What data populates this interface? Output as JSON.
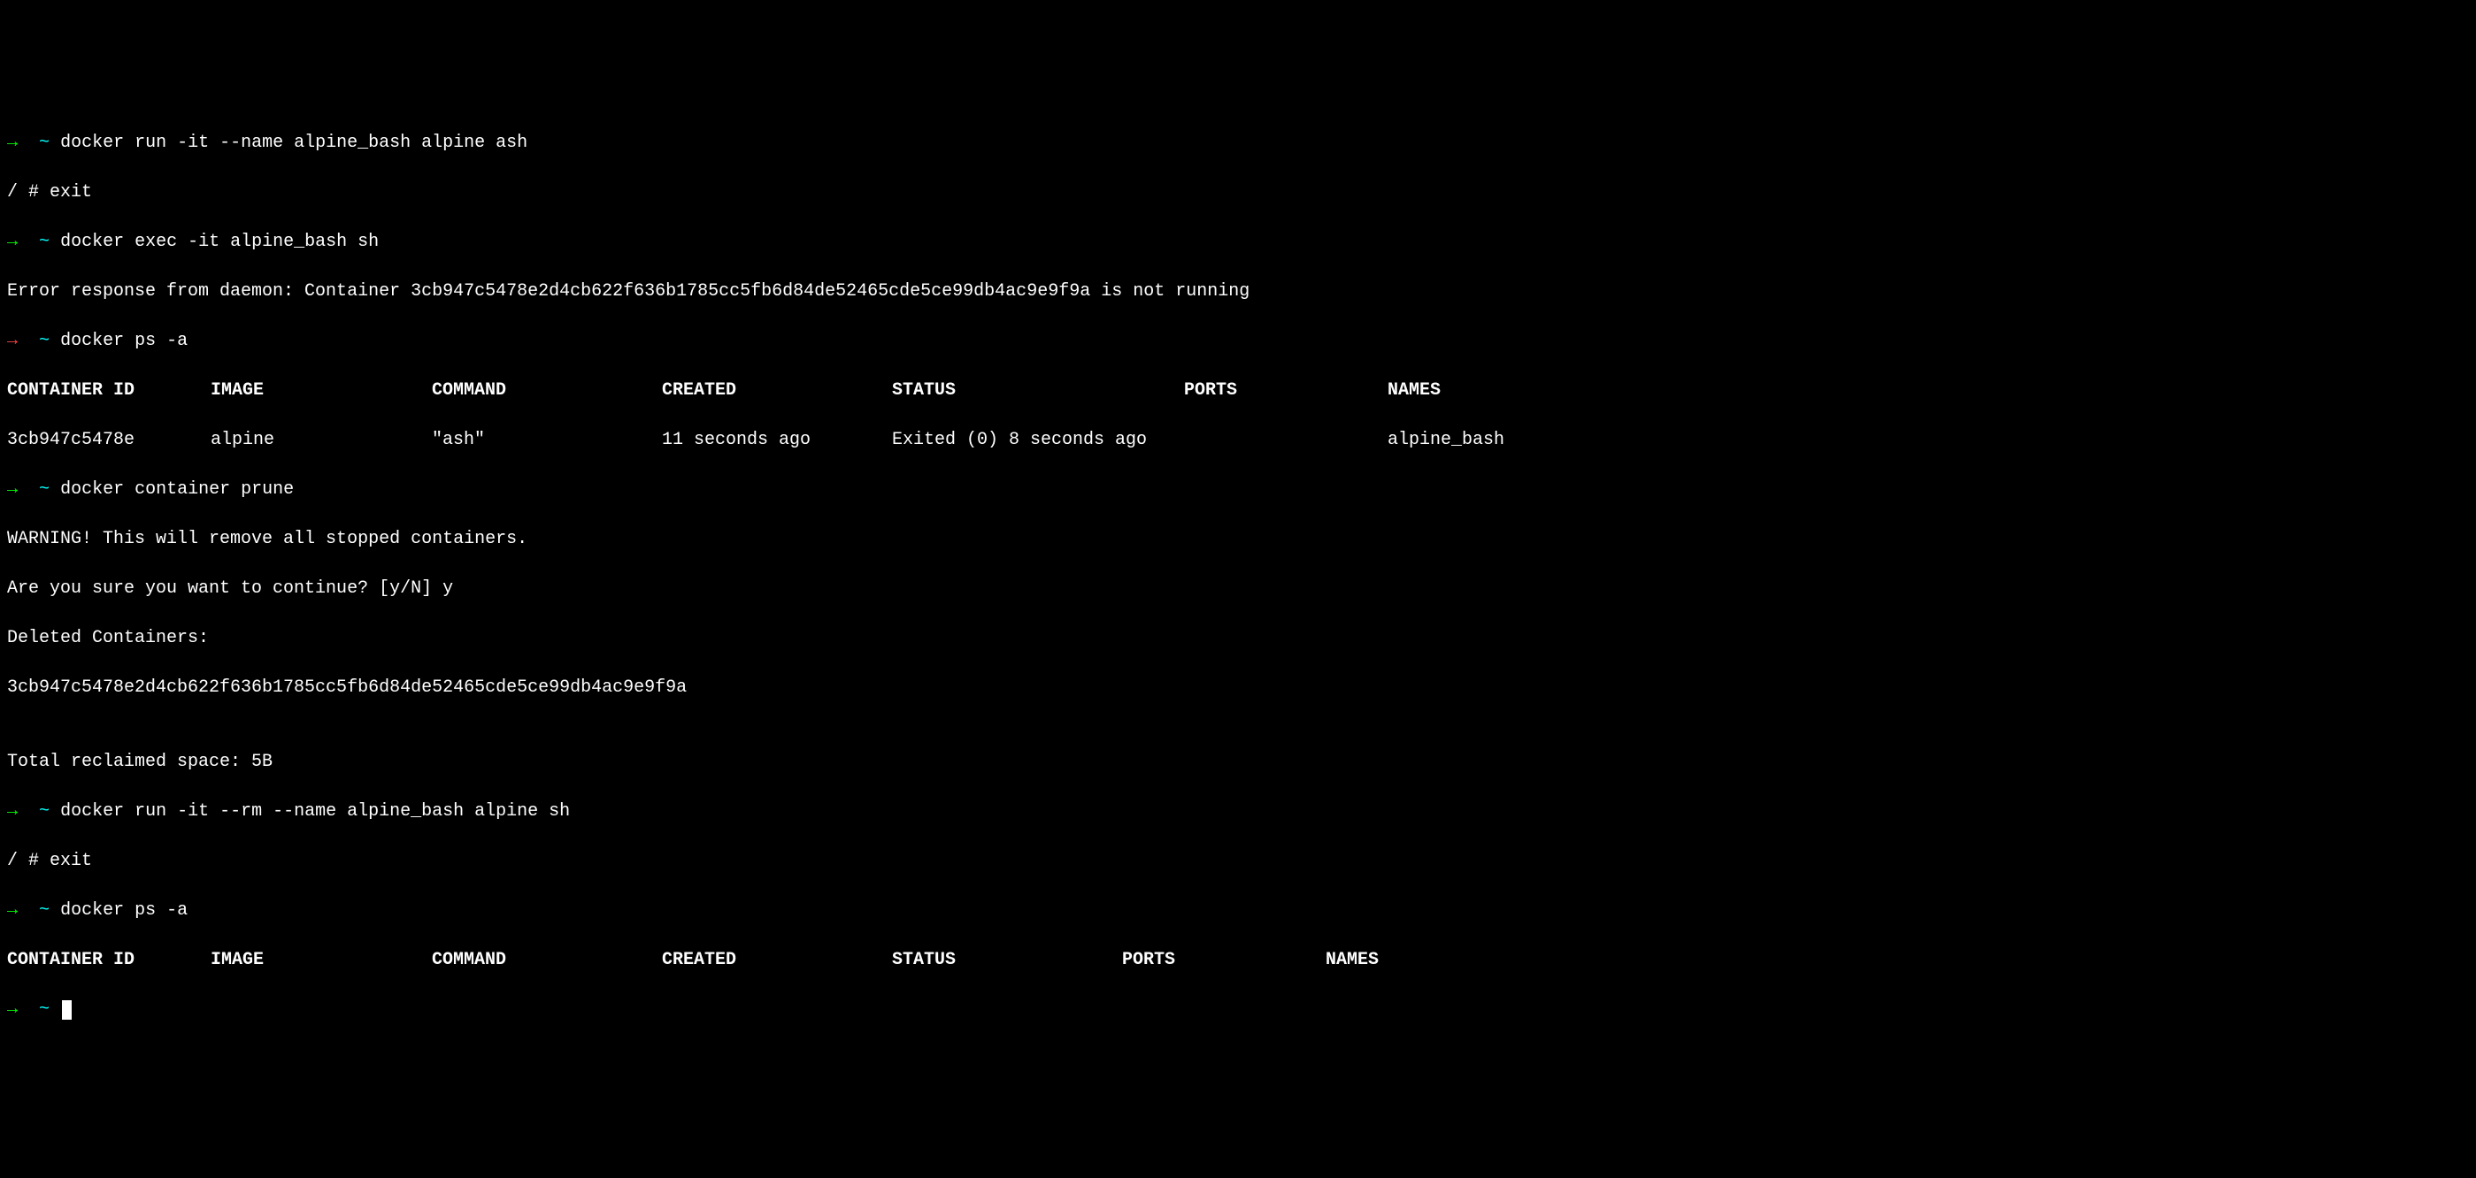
{
  "lines": {
    "l1": {
      "arrow": "→",
      "tilde": "~",
      "command": "docker run -it --name alpine_bash alpine ash"
    },
    "l2": {
      "text": "/ # exit"
    },
    "l3": {
      "arrow": "→",
      "tilde": "~",
      "command": "docker exec -it alpine_bash sh"
    },
    "l4": {
      "text": "Error response from daemon: Container 3cb947c5478e2d4cb622f636b1785cc5fb6d84de52465cde5ce99db4ac9e9f9a is not running"
    },
    "l5": {
      "arrow": "→",
      "tilde": "~",
      "command": "docker ps -a"
    },
    "table1": {
      "headers": {
        "id": "CONTAINER ID",
        "image": "IMAGE",
        "command": "COMMAND",
        "created": "CREATED",
        "status": "STATUS",
        "ports": "PORTS",
        "names": "NAMES"
      },
      "row": {
        "id": "3cb947c5478e",
        "image": "alpine",
        "command": "\"ash\"",
        "created": "11 seconds ago",
        "status": "Exited (0) 8 seconds ago",
        "ports": "",
        "names": "alpine_bash"
      }
    },
    "l8": {
      "arrow": "→",
      "tilde": "~",
      "command": "docker container prune"
    },
    "l9": {
      "text": "WARNING! This will remove all stopped containers."
    },
    "l10": {
      "text": "Are you sure you want to continue? [y/N] y"
    },
    "l11": {
      "text": "Deleted Containers:"
    },
    "l12": {
      "text": "3cb947c5478e2d4cb622f636b1785cc5fb6d84de52465cde5ce99db4ac9e9f9a"
    },
    "l13": {
      "text": ""
    },
    "l14": {
      "text": "Total reclaimed space: 5B"
    },
    "l15": {
      "arrow": "→",
      "tilde": "~",
      "command": "docker run -it --rm --name alpine_bash alpine sh"
    },
    "l16": {
      "text": "/ # exit"
    },
    "l17": {
      "arrow": "→",
      "tilde": "~",
      "command": "docker ps -a"
    },
    "table2": {
      "headers": {
        "id": "CONTAINER ID",
        "image": "IMAGE",
        "command": "COMMAND",
        "created": "CREATED",
        "status": "STATUS",
        "ports": "PORTS",
        "names": "NAMES"
      }
    },
    "l19": {
      "arrow": "→",
      "tilde": "~"
    }
  }
}
